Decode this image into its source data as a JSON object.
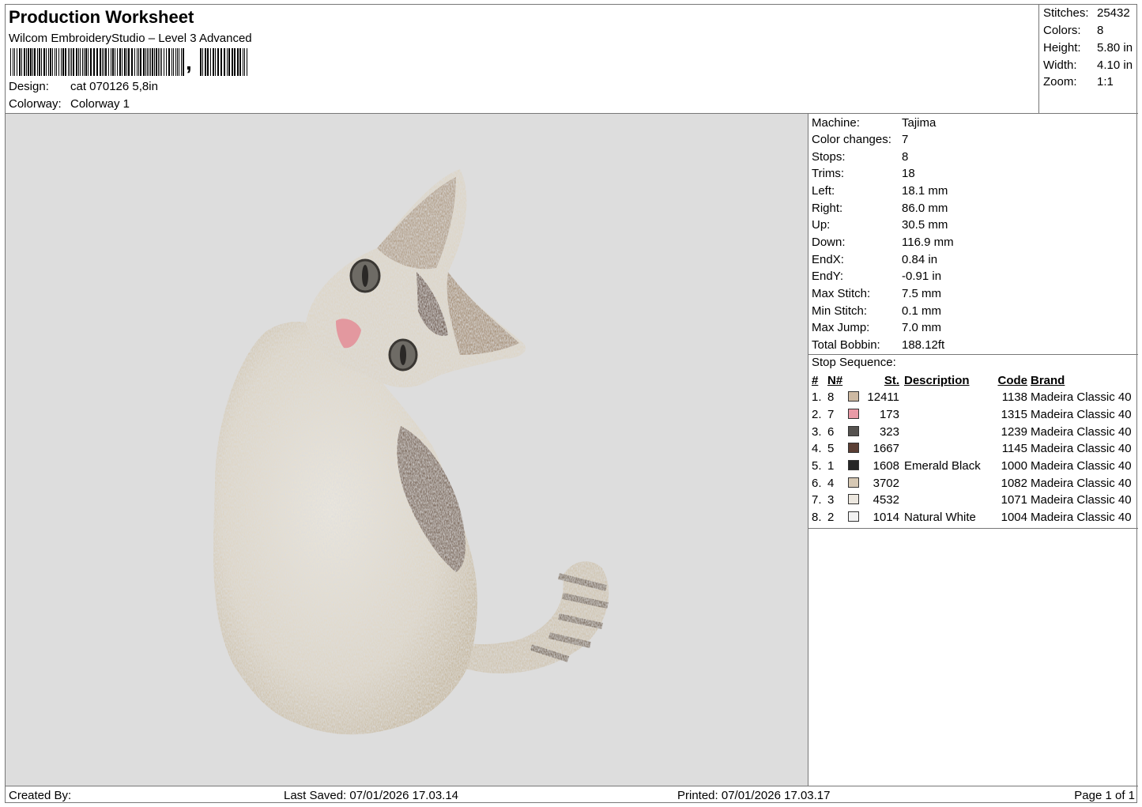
{
  "header": {
    "title": "Production Worksheet",
    "software": "Wilcom EmbroideryStudio – Level 3 Advanced",
    "barcode_suffix": ",",
    "design_label": "Design:",
    "design_value": "cat 070126 5,8in",
    "colorway_label": "Colorway:",
    "colorway_value": "Colorway 1"
  },
  "stats": [
    {
      "label": "Stitches:",
      "value": "25432"
    },
    {
      "label": "Colors:",
      "value": "8"
    },
    {
      "label": "Height:",
      "value": "5.80 in"
    },
    {
      "label": "Width:",
      "value": "4.10 in"
    },
    {
      "label": "Zoom:",
      "value": "1:1"
    }
  ],
  "machine_info": [
    {
      "label": "Machine:",
      "value": "Tajima"
    },
    {
      "label": "Color changes:",
      "value": "7"
    },
    {
      "label": "Stops:",
      "value": "8"
    },
    {
      "label": "Trims:",
      "value": "18"
    },
    {
      "label": "Left:",
      "value": "18.1 mm"
    },
    {
      "label": "Right:",
      "value": "86.0 mm"
    },
    {
      "label": "Up:",
      "value": "30.5 mm"
    },
    {
      "label": "Down:",
      "value": "116.9 mm"
    },
    {
      "label": "EndX:",
      "value": "0.84 in"
    },
    {
      "label": "EndY:",
      "value": "-0.91 in"
    },
    {
      "label": "Max Stitch:",
      "value": "7.5 mm"
    },
    {
      "label": "Min Stitch:",
      "value": "0.1 mm"
    },
    {
      "label": "Max Jump:",
      "value": "7.0 mm"
    },
    {
      "label": "Total Bobbin:",
      "value": "188.12ft"
    }
  ],
  "stop_sequence": {
    "title": "Stop Sequence:",
    "headers": {
      "idx": "#",
      "n": "N#",
      "st": "St.",
      "desc": "Description",
      "code": "Code",
      "brand": "Brand"
    },
    "rows": [
      {
        "idx": "1.",
        "n": "8",
        "color": "#cdb9a2",
        "st": "12411",
        "desc": "",
        "code": "1138",
        "brand": "Madeira Classic 40"
      },
      {
        "idx": "2.",
        "n": "7",
        "color": "#e89aa6",
        "st": "173",
        "desc": "",
        "code": "1315",
        "brand": "Madeira Classic 40"
      },
      {
        "idx": "3.",
        "n": "6",
        "color": "#55524f",
        "st": "323",
        "desc": "",
        "code": "1239",
        "brand": "Madeira Classic 40"
      },
      {
        "idx": "4.",
        "n": "5",
        "color": "#5a3e34",
        "st": "1667",
        "desc": "",
        "code": "1145",
        "brand": "Madeira Classic 40"
      },
      {
        "idx": "5.",
        "n": "1",
        "color": "#262626",
        "st": "1608",
        "desc": "Emerald Black",
        "code": "1000",
        "brand": "Madeira Classic 40"
      },
      {
        "idx": "6.",
        "n": "4",
        "color": "#d6c8b4",
        "st": "3702",
        "desc": "",
        "code": "1082",
        "brand": "Madeira Classic 40"
      },
      {
        "idx": "7.",
        "n": "3",
        "color": "#ece7df",
        "st": "4532",
        "desc": "",
        "code": "1071",
        "brand": "Madeira Classic 40"
      },
      {
        "idx": "8.",
        "n": "2",
        "color": "#f2f2f2",
        "st": "1014",
        "desc": "Natural White",
        "code": "1004",
        "brand": "Madeira Classic 40"
      }
    ]
  },
  "footer": {
    "created_by": "Created By:",
    "last_saved": "Last Saved: 07/01/2026 17.03.14",
    "printed": "Printed: 07/01/2026 17.03.17",
    "page": "Page 1 of 1"
  },
  "preview": {
    "background": "#dddddd",
    "subject": "embroidered-cat"
  }
}
